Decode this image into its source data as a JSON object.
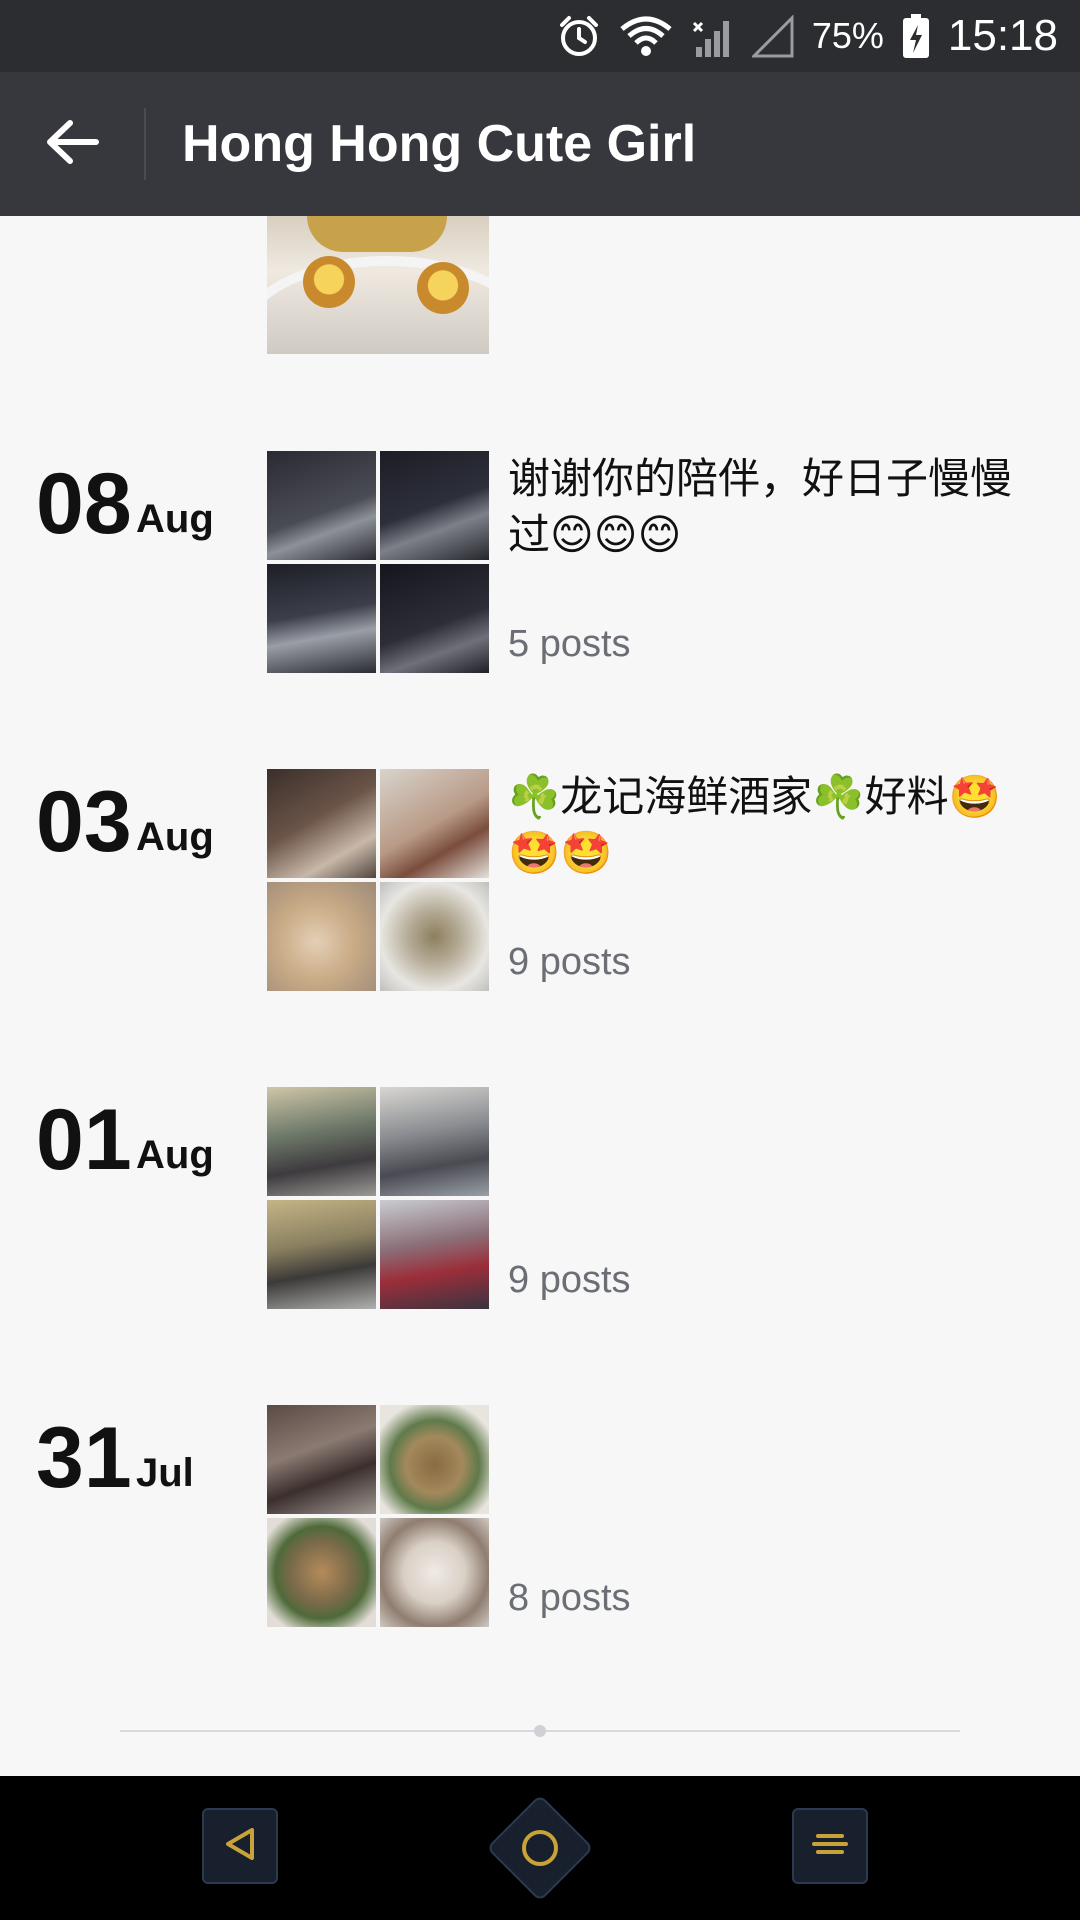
{
  "status_bar": {
    "battery": "75%",
    "time": "15:18",
    "icons": [
      "alarm-icon",
      "wifi-icon",
      "cell-signal-icon",
      "cell-signal-empty-icon",
      "battery-charging-icon"
    ]
  },
  "app_bar": {
    "title": "Hong Hong Cute Girl",
    "back_icon": "arrow-left-icon"
  },
  "posts": [
    {
      "day": "08",
      "month": "Aug",
      "caption": "谢谢你的陪伴，好日子慢慢过😊😊😊",
      "count": "5 posts"
    },
    {
      "day": "03",
      "month": "Aug",
      "caption": "☘️龙记海鲜酒家☘️好料🤩🤩🤩",
      "count": "9 posts"
    },
    {
      "day": "01",
      "month": "Aug",
      "caption": "",
      "count": "9 posts"
    },
    {
      "day": "31",
      "month": "Jul",
      "caption": "",
      "count": "8 posts"
    }
  ],
  "nav_bar": {
    "icons": [
      "nav-back-icon",
      "nav-home-icon",
      "nav-menu-icon"
    ]
  },
  "colors": {
    "status_bar_bg": "#2b2d31",
    "app_bar_bg": "#36383d",
    "content_bg": "#f7f7f8",
    "count_text": "#6b6f75",
    "nav_accent": "#c9a23a"
  }
}
